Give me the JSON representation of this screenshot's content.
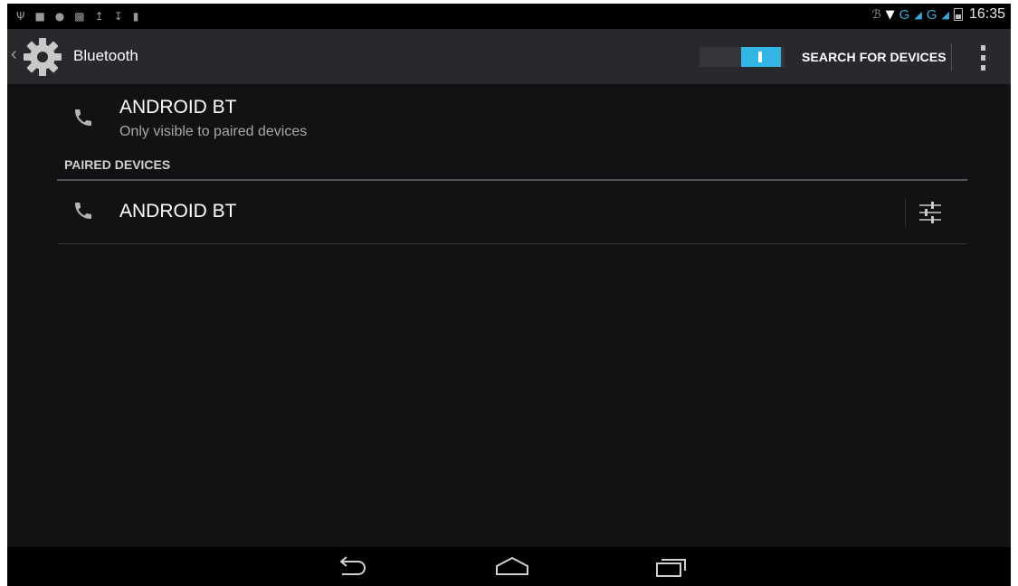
{
  "status_bar": {
    "left_icons": [
      "usb-icon",
      "lock-icon",
      "sync-icon",
      "screenshot-icon",
      "upload-icon",
      "download-icon",
      "sd-card-icon"
    ],
    "right_icons": [
      "bluetooth-icon",
      "wifi-icon",
      "signal-icon",
      "battery-icon"
    ],
    "network_label_1": "G",
    "network_label_2": "G",
    "time": "16:35"
  },
  "action_bar": {
    "title": "Bluetooth",
    "toggle_state": "on",
    "search_button": "SEARCH FOR DEVICES"
  },
  "local_device": {
    "name": "ANDROID BT",
    "visibility": "Only visible to paired devices"
  },
  "paired_section": {
    "header": "PAIRED DEVICES",
    "devices": [
      {
        "name": "ANDROID BT"
      }
    ]
  },
  "nav_bar": {
    "buttons": [
      "back",
      "home",
      "recent-apps"
    ]
  },
  "colors": {
    "accent": "#33b5e5",
    "background": "#111214",
    "action_bar": "#27292c"
  }
}
